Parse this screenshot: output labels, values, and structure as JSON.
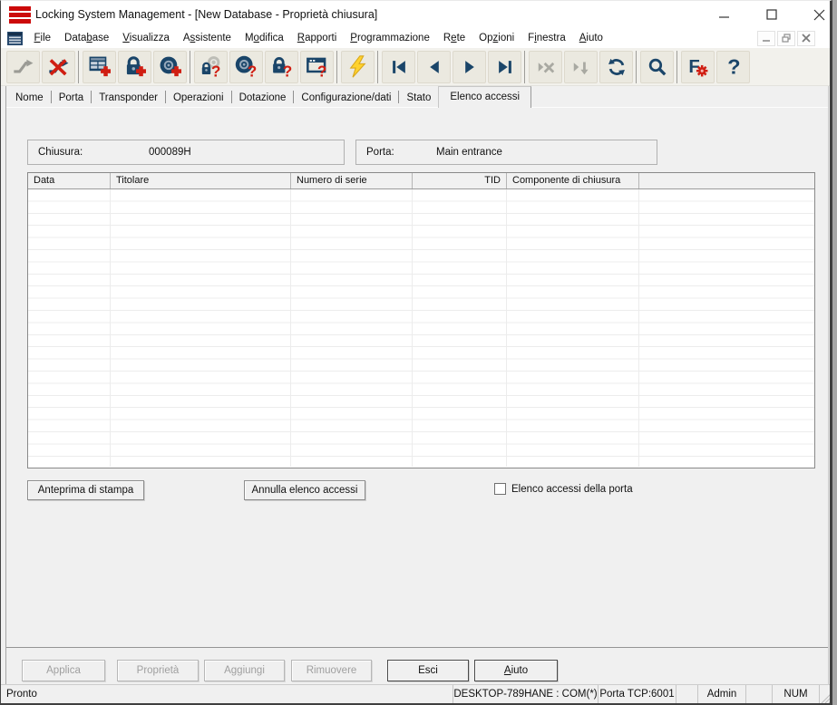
{
  "titlebar": {
    "title": "Locking System Management - [New Database - Proprietà chiusura]"
  },
  "menu": {
    "items": [
      {
        "pre": "",
        "key": "F",
        "post": "ile"
      },
      {
        "pre": "Data",
        "key": "b",
        "post": "ase"
      },
      {
        "pre": "",
        "key": "V",
        "post": "isualizza"
      },
      {
        "pre": "A",
        "key": "s",
        "post": "sistente"
      },
      {
        "pre": "M",
        "key": "o",
        "post": "difica"
      },
      {
        "pre": "",
        "key": "R",
        "post": "apporti"
      },
      {
        "pre": "",
        "key": "P",
        "post": "rogrammazione"
      },
      {
        "pre": "R",
        "key": "e",
        "post": "te"
      },
      {
        "pre": "Op",
        "key": "z",
        "post": "ioni"
      },
      {
        "pre": "F",
        "key": "i",
        "post": "nestra"
      },
      {
        "pre": "",
        "key": "A",
        "post": "iuto"
      }
    ]
  },
  "toolbar": {
    "icons": [
      "connect",
      "disconnect",
      "new-matrix",
      "new-lock",
      "new-transponder",
      "read-lock-transponder",
      "read-transponder",
      "read-lock",
      "read-network",
      "programming-flash",
      "nav-first",
      "nav-previous",
      "nav-next",
      "nav-last",
      "cancel-action",
      "skip-down",
      "refresh",
      "search",
      "filter-settings",
      "help"
    ]
  },
  "tabs": {
    "items": [
      "Nome",
      "Porta",
      "Transponder",
      "Operazioni",
      "Dotazione",
      "Configurazione/dati",
      "Stato",
      "Elenco accessi"
    ],
    "active": "Elenco accessi"
  },
  "fields": {
    "chiusura_label": "Chiusura:",
    "chiusura_value": "000089H",
    "porta_label": "Porta:",
    "porta_value": "Main entrance"
  },
  "table": {
    "columns": [
      "Data",
      "Titolare",
      "Numero di serie",
      "TID",
      "Componente di chiusura",
      ""
    ],
    "rows": []
  },
  "actions": {
    "print_preview": "Anteprima di stampa",
    "cancel_access_list": "Annulla elenco accessi",
    "door_access_checkbox": {
      "label": "Elenco accessi della porta",
      "checked": false
    }
  },
  "footer_buttons": {
    "applica": {
      "label": "Applica",
      "enabled": false
    },
    "proprieta": {
      "label": "Proprietà",
      "enabled": false
    },
    "aggiungi": {
      "label": "Aggiungi",
      "enabled": false
    },
    "rimuovere": {
      "label": "Rimuovere",
      "enabled": false
    },
    "esci": {
      "label": "Esci",
      "enabled": true
    },
    "aiuto": {
      "pre": "",
      "key": "A",
      "post": "iuto",
      "enabled": true
    }
  },
  "statusbar": {
    "status": "Pronto",
    "panels": [
      "DESKTOP-789HANE : COM(*)",
      "Porta TCP:6001",
      "",
      "Admin",
      "",
      "NUM"
    ]
  },
  "colors": {
    "icon_navy": "#1a4569",
    "icon_red": "#d01e12",
    "icon_yellow": "#ffd22e",
    "title_icon_red": "#cc0a0a"
  }
}
